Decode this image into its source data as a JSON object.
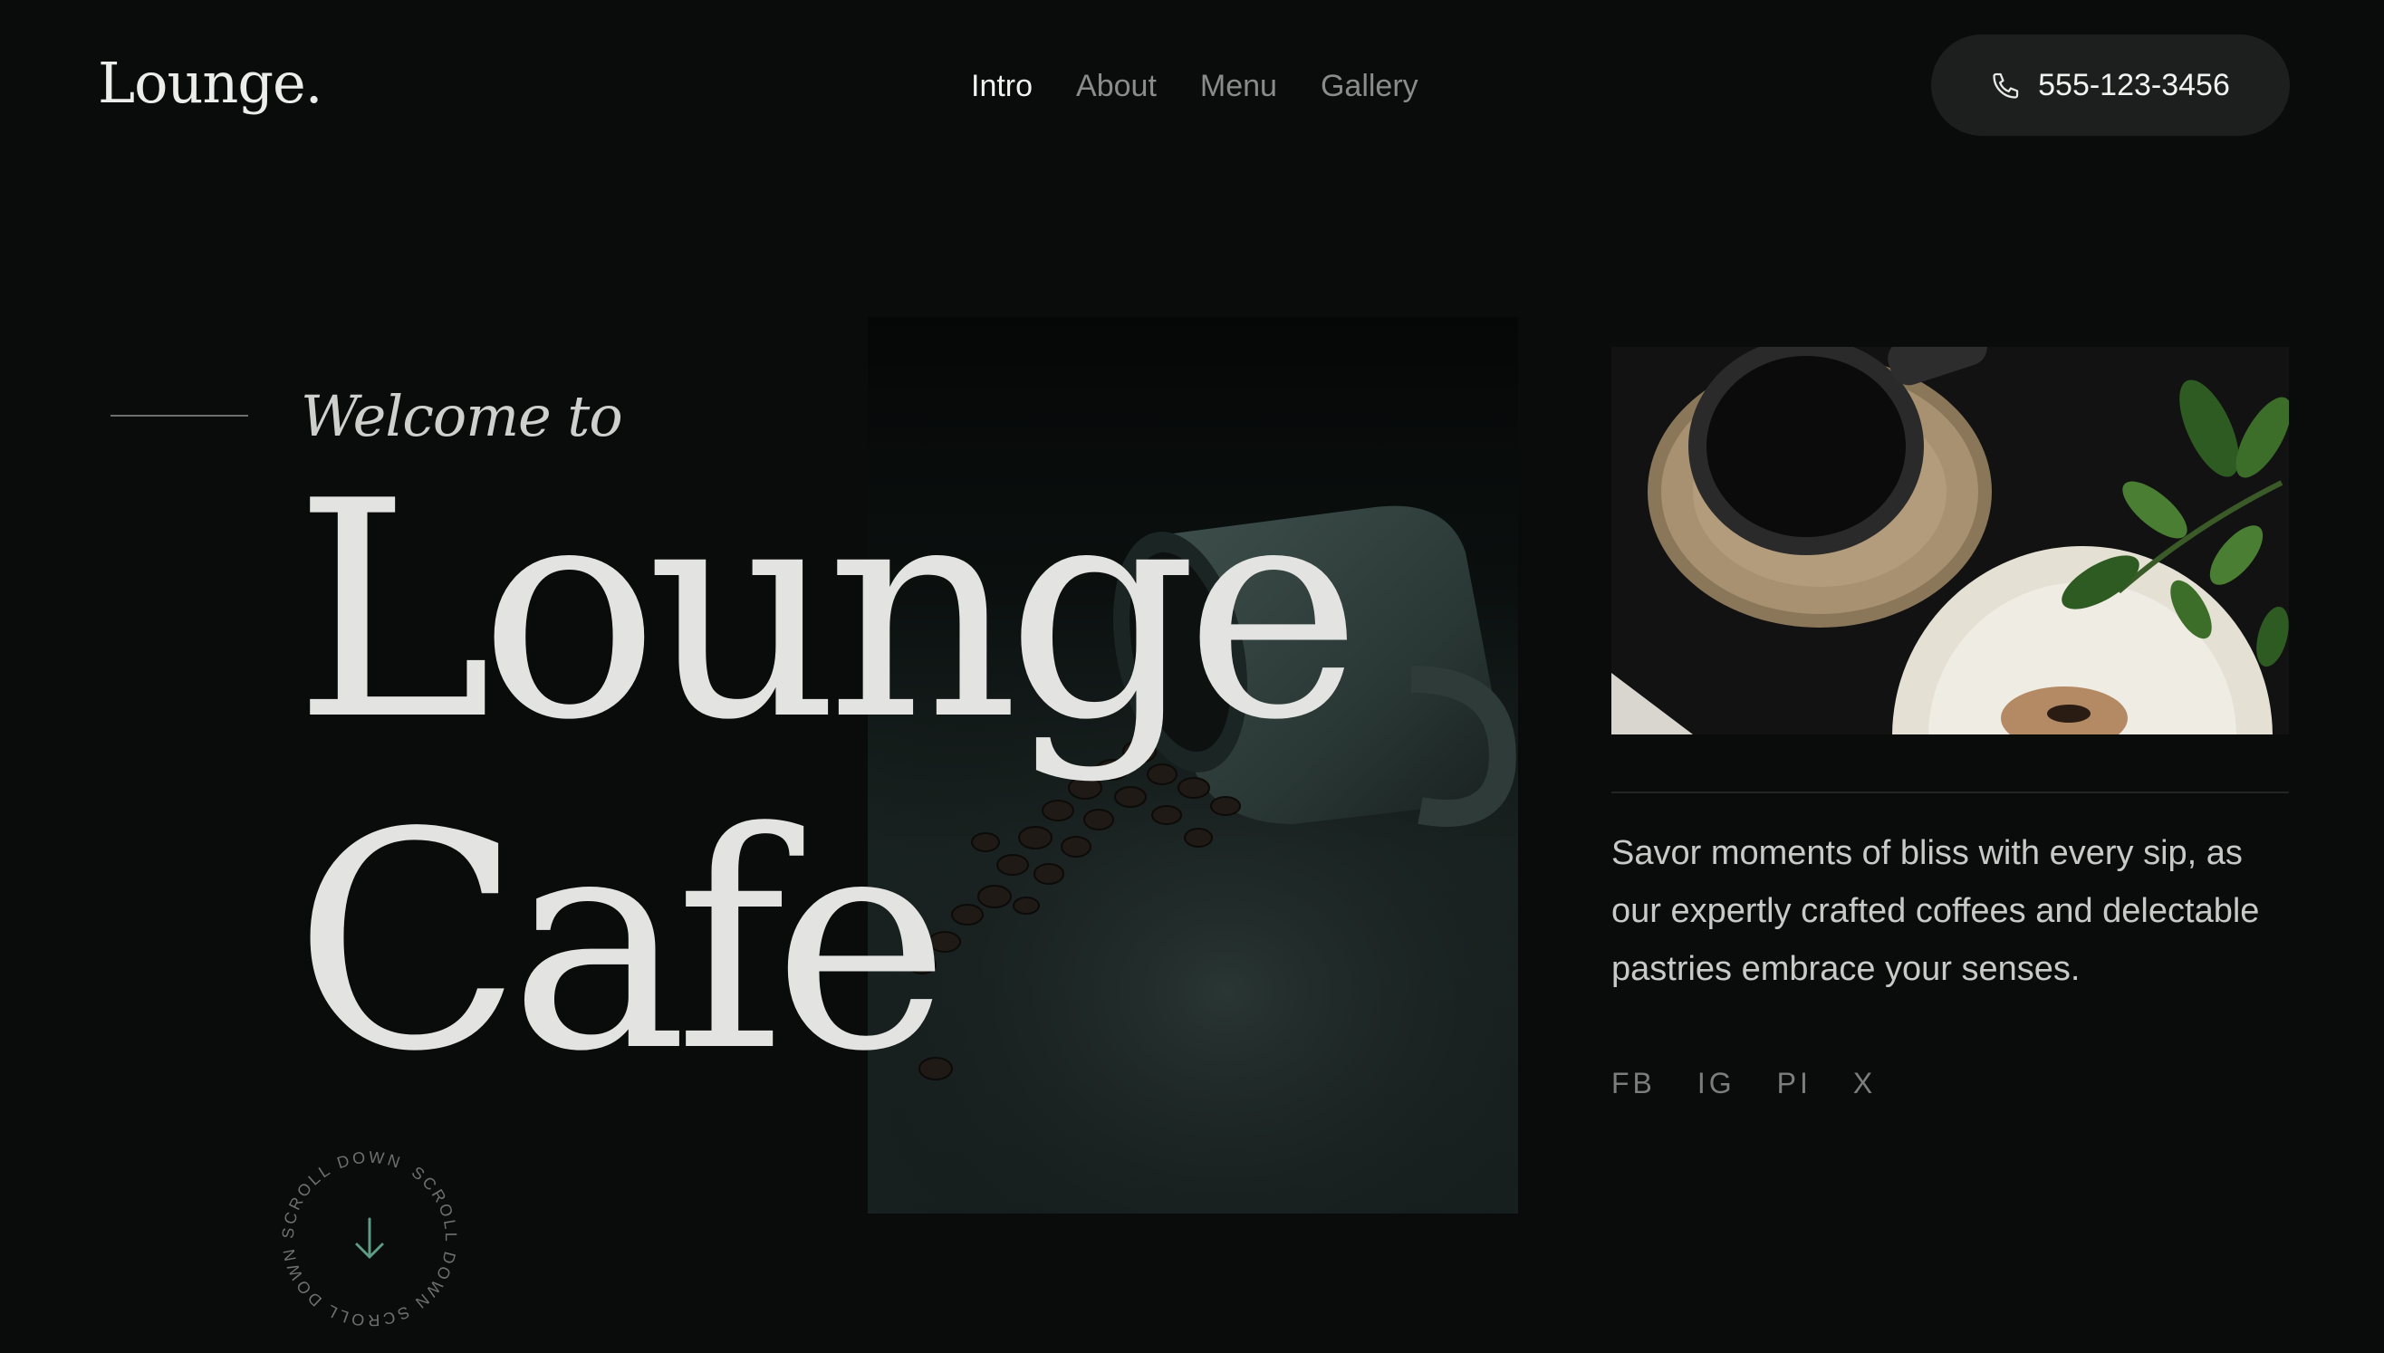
{
  "header": {
    "logo": "Lounge.",
    "nav": [
      "Intro",
      "About",
      "Menu",
      "Gallery"
    ],
    "phone": "555-123-3456",
    "phone_icon": "phone-icon"
  },
  "hero": {
    "welcome": "Welcome to",
    "title_line1": "Lounge",
    "title_line2": "Cafe",
    "photo": "coffee-cup-spilled-beans-photo"
  },
  "scroll": {
    "label": "SCROLL DOWN",
    "icon": "arrow-down-icon"
  },
  "side": {
    "photo": "coffee-and-pastry-top-view-photo",
    "tagline": "Savor moments of bliss with every sip, as our expertly crafted coffees and delectable pastries embrace your senses.",
    "socials": [
      "FB",
      "IG",
      "PI",
      "X"
    ]
  },
  "colors": {
    "background": "#0a0c0c",
    "text": "#e3e4e2",
    "muted": "#7c7e7d",
    "accent": "#5f9c86"
  }
}
